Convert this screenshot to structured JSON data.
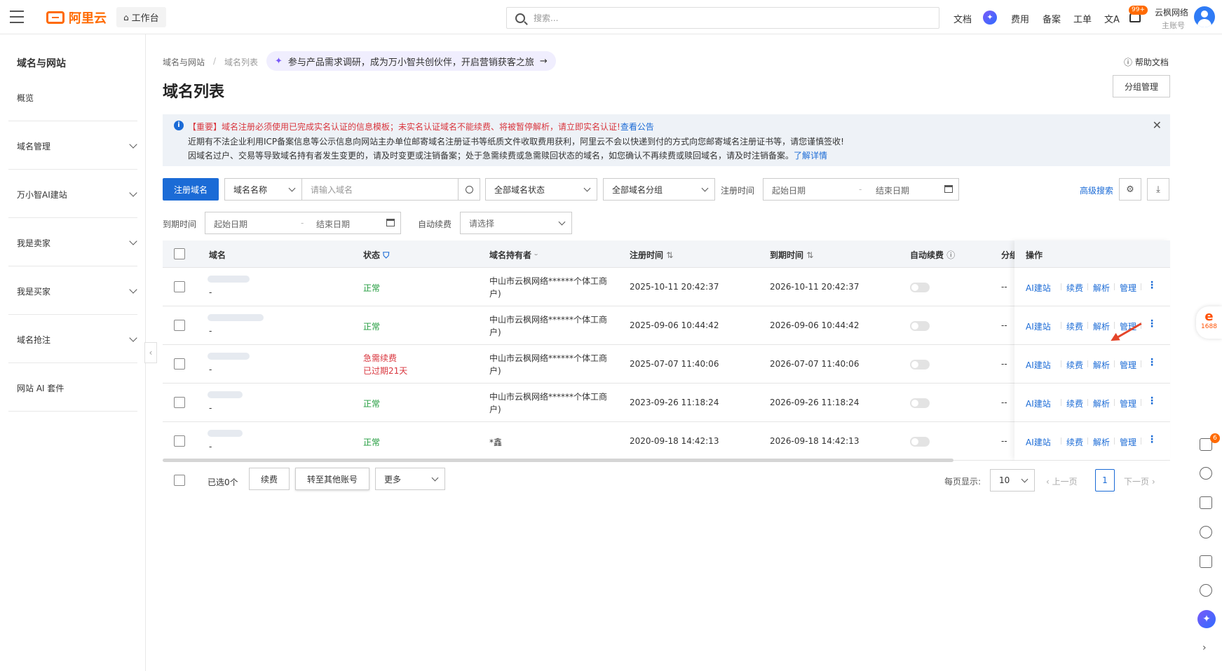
{
  "header": {
    "brand": "阿里云",
    "workbench": "工作台",
    "search_placeholder": "搜索...",
    "nav": [
      "文档",
      "费用",
      "备案",
      "工单"
    ],
    "notification_badge": "99+",
    "account_name": "云枫网络",
    "account_sub": "主账号"
  },
  "sidebar": {
    "title": "域名与网站",
    "items": [
      {
        "label": "概览"
      },
      {
        "label": "域名管理"
      },
      {
        "label": "万小智AI建站"
      },
      {
        "label": "我是卖家"
      },
      {
        "label": "我是买家"
      },
      {
        "label": "域名抢注"
      },
      {
        "label": "网站 AI 套件"
      }
    ]
  },
  "breadcrumb": [
    "域名与网站",
    "域名列表"
  ],
  "breadcrumb_sep": "/",
  "promo": "参与产品需求调研，成为万小智共创伙伴，开启营销获客之旅",
  "page_title": "域名列表",
  "help_doc": "帮助文档",
  "group_mgmt": "分组管理",
  "notice": {
    "line1_tag": "【重要】",
    "line1_text": "域名注册必须使用已完成实名认证的信息模板；未实名认证域名不能续费、将被暂停解析，请立即实名认证!",
    "line1_link": "查看公告",
    "line2": "近期有不法企业利用ICP备案信息等公示信息向网站主办单位邮寄域名注册证书等纸质文件收取费用获利，阿里云不会以快递到付的方式向您邮寄域名注册证书等，请您谨慎签收!",
    "line3": "因域名过户、交易等导致域名持有者发生变更的，请及时变更或注销备案；处于急需续费或急需赎回状态的域名，如您确认不再续费或赎回域名，请及时注销备案。",
    "line3_link": "了解详情"
  },
  "filters": {
    "register_btn": "注册域名",
    "name_select": "域名名称",
    "domain_placeholder": "请输入域名",
    "status_select": "全部域名状态",
    "group_select": "全部域名分组",
    "reg_time_label": "注册时间",
    "start_date": "起始日期",
    "end_date": "结束日期",
    "date_sep": "-",
    "advanced": "高级搜索",
    "expire_label": "到期时间",
    "auto_renew_label": "自动续费",
    "auto_renew_placeholder": "请选择"
  },
  "table": {
    "columns": [
      "域名",
      "状态",
      "域名持有者",
      "注册时间",
      "到期时间",
      "自动续费",
      "分组",
      "操作"
    ],
    "rows": [
      {
        "domain": "-",
        "status": "正常",
        "status2": "",
        "holder1": "中山市云枫网络******个体工商",
        "holder2": "户)",
        "reg": "2025-10-11 20:42:37",
        "exp": "2026-10-11 20:42:37",
        "group": "--"
      },
      {
        "domain": "-",
        "status": "正常",
        "status2": "",
        "holder1": "中山市云枫网络******个体工商",
        "holder2": "户)",
        "reg": "2025-09-06 10:44:42",
        "exp": "2026-09-06 10:44:42",
        "group": "--"
      },
      {
        "domain": "-",
        "status": "急需续费",
        "status2": "已过期21天",
        "holder1": "中山市云枫网络******个体工商",
        "holder2": "户)",
        "reg": "2025-07-07 11:40:06",
        "exp": "2026-07-07 11:40:06",
        "group": "--"
      },
      {
        "domain": "-",
        "status": "正常",
        "status2": "",
        "holder1": "中山市云枫网络******个体工商",
        "holder2": "户)",
        "reg": "2023-09-26 11:18:24",
        "exp": "2026-09-26 11:18:24",
        "group": "--"
      },
      {
        "domain": "-",
        "status": "正常",
        "status2": "",
        "holder1": "*鑫",
        "holder2": "",
        "reg": "2020-09-18 14:42:13",
        "exp": "2026-09-18 14:42:13",
        "group": "--"
      }
    ],
    "ops": [
      "AI建站",
      "续费",
      "解析",
      "管理"
    ],
    "kebab": "⋮"
  },
  "footer": {
    "selected": "已选0个",
    "renew": "续费",
    "transfer": "转至其他账号",
    "more": "更多",
    "per_page_label": "每页显示:",
    "per_page": "10",
    "prev": "上一页",
    "page": "1",
    "next": "下一页"
  },
  "float_1688": "1688",
  "rail_badge": "6"
}
